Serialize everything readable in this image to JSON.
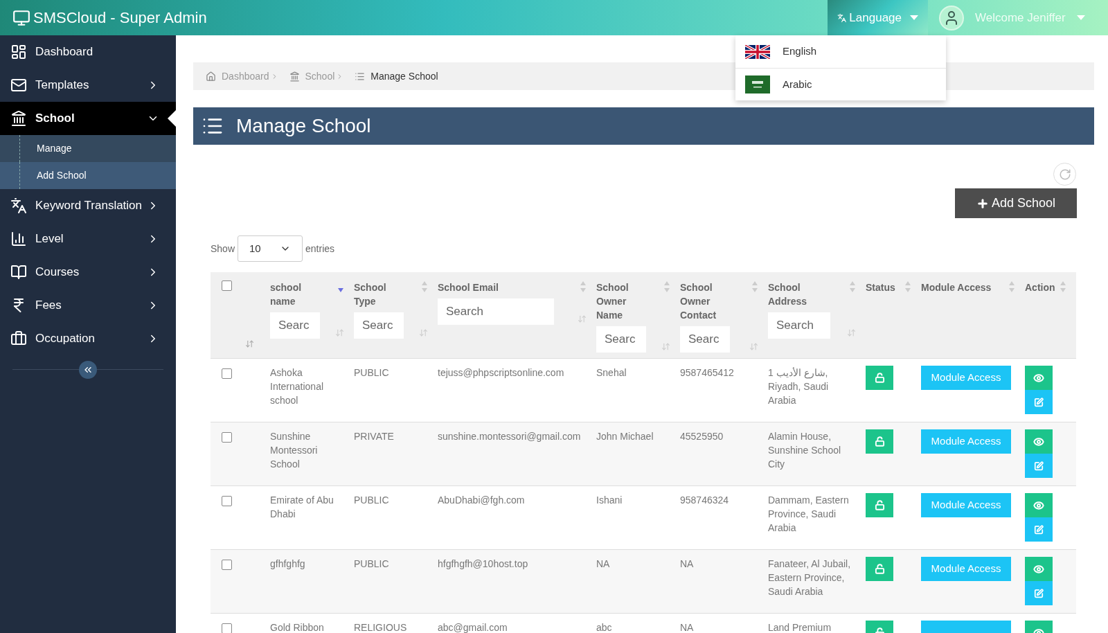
{
  "header": {
    "title": "SMSCloud - Super Admin",
    "language": {
      "label": "Language",
      "expanded": true,
      "options": [
        {
          "label": "English"
        },
        {
          "label": "Arabic"
        }
      ]
    },
    "user": {
      "label": "Welcome Jeniffer"
    }
  },
  "sidebar": {
    "items": [
      {
        "label": "Dashboard",
        "has_arrow": false,
        "selected": false
      },
      {
        "label": "Templates",
        "has_arrow": true,
        "expanded": false,
        "selected": false
      },
      {
        "label": "School",
        "has_arrow": true,
        "expanded": true,
        "selected": true,
        "children": [
          {
            "label": "Manage",
            "selected": false
          },
          {
            "label": "Add School",
            "selected": true
          }
        ]
      },
      {
        "label": "Keyword Translation",
        "has_arrow": true,
        "expanded": false,
        "selected": false
      },
      {
        "label": "Level",
        "has_arrow": true,
        "expanded": false,
        "selected": false
      },
      {
        "label": "Courses",
        "has_arrow": true,
        "expanded": false,
        "selected": false
      },
      {
        "label": "Fees",
        "has_arrow": true,
        "expanded": false,
        "selected": false
      },
      {
        "label": "Occupation",
        "has_arrow": true,
        "expanded": false,
        "selected": false
      }
    ]
  },
  "breadcrumb": [
    {
      "label": "Dashboard"
    },
    {
      "label": "School"
    },
    {
      "label": "Manage School"
    }
  ],
  "page_title": "Manage School",
  "add_button": "Add School",
  "show_entries": {
    "show": "Show",
    "value": "10",
    "entries": "entries"
  },
  "table": {
    "select_all_checked": false,
    "columns": [
      {
        "label": "school name",
        "placeholder": "Searc",
        "sorted": true
      },
      {
        "label": "School Type",
        "placeholder": "Searc",
        "sorted": false
      },
      {
        "label": "School Email",
        "placeholder": "Search",
        "sorted": false
      },
      {
        "label": "School Owner Name",
        "placeholder": "Searc",
        "sorted": false
      },
      {
        "label": "School Owner Contact",
        "placeholder": "Searc",
        "sorted": false
      },
      {
        "label": "School Address",
        "placeholder": "Search",
        "sorted": false
      },
      {
        "label": "Status",
        "sorted": false
      },
      {
        "label": "Module Access",
        "sorted": false
      },
      {
        "label": "Action",
        "sorted": false
      }
    ],
    "rows": [
      {
        "checked": false,
        "cells": [
          "Ashoka International school",
          "PUBLIC",
          "tejuss@phpscriptsonline.com",
          "Snehal",
          "9587465412",
          "1 شارع الأديب, Riyadh, Saudi Arabia"
        ],
        "module": "Module Access"
      },
      {
        "checked": false,
        "cells": [
          "Sunshine Montessori School",
          "PRIVATE",
          "sunshine.montessori@gmail.com",
          "John Michael",
          "45525950",
          "Alamin House, Sunshine School City"
        ],
        "module": "Module Access"
      },
      {
        "checked": false,
        "cells": [
          "Emirate of Abu Dhabi",
          "PUBLIC",
          "AbuDhabi@fgh.com",
          "Ishani",
          "958746324",
          "Dammam, Eastern Province, Saudi Arabia"
        ],
        "module": "Module Access"
      },
      {
        "checked": false,
        "cells": [
          "gfhfghfg",
          "PUBLIC",
          "hfgfhgfh@10host.top",
          "NA",
          "NA",
          "Fanateer, Al Jubail, Eastern Province, Saudi Arabia"
        ],
        "module": "Module Access"
      },
      {
        "checked": false,
        "cells": [
          "Gold Ribbon",
          "RELIGIOUS",
          "abc@gmail.com",
          "abc",
          "NA",
          "Land Premium"
        ]
      }
    ]
  }
}
